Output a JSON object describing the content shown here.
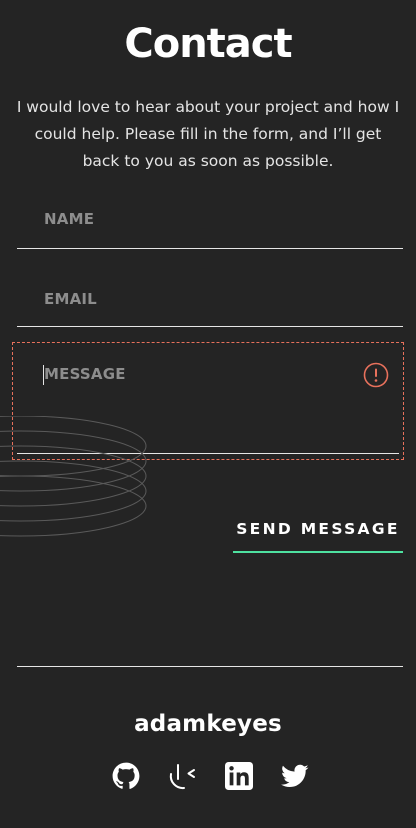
{
  "page": {
    "title": "Contact",
    "intro": "I would love to hear about your project and how I could help. Please fill in the form, and I’ll get back to you as soon as possible."
  },
  "form": {
    "name_placeholder": "NAME",
    "email_placeholder": "EMAIL",
    "message_placeholder": "MESSAGE",
    "send_label": "SEND MESSAGE",
    "error_icon": "alert-circle-icon"
  },
  "footer": {
    "name": "adamkeyes",
    "social": [
      "github-icon",
      "frontend-mentor-icon",
      "linkedin-icon",
      "twitter-icon"
    ]
  },
  "colors": {
    "background": "#242424",
    "accent": "#4ee1a0",
    "error": "#e8715c"
  }
}
